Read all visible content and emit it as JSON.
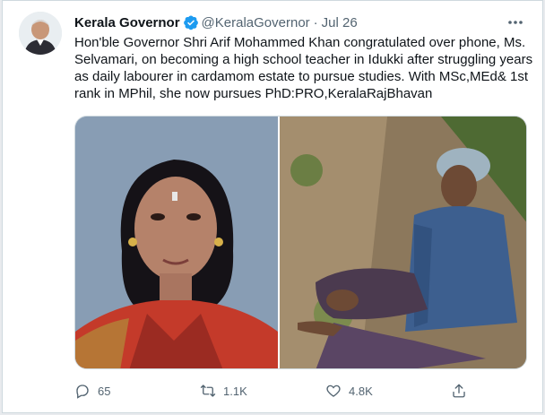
{
  "tweet": {
    "author_name": "Kerala Governor",
    "handle": "@KeralaGovernor",
    "separator": "·",
    "date": "Jul 26",
    "more_icon": "more-horizontal-icon",
    "text": "Hon'ble Governor Shri Arif Mohammed Khan congratulated over phone, Ms. Selvamari, on becoming a high school teacher in Idukki after struggling years as daily labourer in cardamom estate to pursue studies. With MSc,MEd& 1st rank in MPhil, she now pursues  PhD:PRO,KeralaRajBhavan",
    "replies": "65",
    "retweets": "1.1K",
    "likes": "4.8K"
  },
  "colors": {
    "verified": "#1d9bf0",
    "text": "#0f1419",
    "muted": "#536471",
    "border": "#cfd9de"
  }
}
